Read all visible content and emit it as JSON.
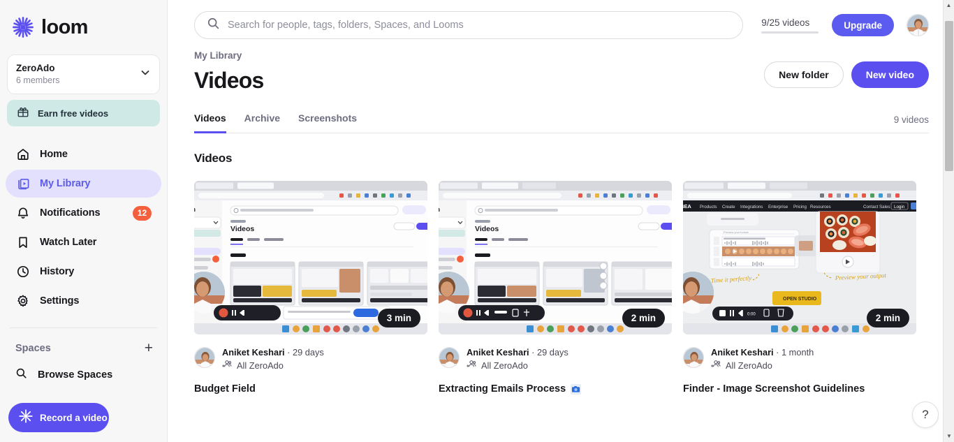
{
  "brand": {
    "name": "loom",
    "logo_icon": "loom-starburst-icon",
    "accent": "#5b4ff0",
    "accent_alt": "#5c5ce8",
    "badge_color": "#f4603e",
    "earn_bg": "#cfe9e6"
  },
  "sidebar": {
    "workspace": {
      "name": "ZeroAdo",
      "members": "6 members",
      "chevron_icon": "chevron-down-icon"
    },
    "earn": {
      "label": "Earn free videos",
      "icon": "gift-icon"
    },
    "items": [
      {
        "label": "Home",
        "icon": "home-icon",
        "active": false
      },
      {
        "label": "My Library",
        "icon": "library-icon",
        "active": true
      },
      {
        "label": "Notifications",
        "icon": "bell-icon",
        "active": false,
        "badge": "12"
      },
      {
        "label": "Watch Later",
        "icon": "bookmark-icon",
        "active": false
      },
      {
        "label": "History",
        "icon": "clock-icon",
        "active": false
      },
      {
        "label": "Settings",
        "icon": "gear-icon",
        "active": false
      }
    ],
    "spaces": {
      "title": "Spaces",
      "add_icon": "plus-icon",
      "browse_label": "Browse Spaces",
      "browse_icon": "search-icon"
    },
    "record": {
      "label": "Record a video",
      "icon": "loom-starburst-icon"
    }
  },
  "topbar": {
    "search": {
      "placeholder": "Search for people, tags, folders, Spaces, and Looms",
      "value": "",
      "icon": "search-icon"
    },
    "quota": {
      "text": "9/25 videos",
      "used": 9,
      "total": 25,
      "percent": 36
    },
    "upgrade_label": "Upgrade",
    "avatar": "user-avatar"
  },
  "page": {
    "breadcrumb": "My Library",
    "title": "Videos",
    "new_folder_label": "New folder",
    "new_video_label": "New video",
    "tabs": [
      {
        "label": "Videos",
        "active": true
      },
      {
        "label": "Archive",
        "active": false
      },
      {
        "label": "Screenshots",
        "active": false
      }
    ],
    "count_text": "9 videos",
    "section_title": "Videos"
  },
  "videos": [
    {
      "title": "Budget Field",
      "title_emoji": "",
      "author": "Aniket Keshari",
      "age": "29 days",
      "space": "All ZeroAdo",
      "space_icon": "people-group-icon",
      "duration": "3 min",
      "thumbnail_kind": "loom-library-recursive"
    },
    {
      "title": "Extracting Emails Process",
      "title_emoji": "📷",
      "author": "Aniket Keshari",
      "age": "29 days",
      "space": "All ZeroAdo",
      "space_icon": "people-group-icon",
      "duration": "2 min",
      "thumbnail_kind": "loom-library-recursive"
    },
    {
      "title": "Finder - Image Screenshot Guidelines",
      "title_emoji": "",
      "author": "Aniket Keshari",
      "age": "1 month",
      "space": "All ZeroAdo",
      "space_icon": "people-group-icon",
      "duration": "2 min",
      "thumbnail_kind": "media-studio-sushi",
      "thumbnail_texts": {
        "cta": "OPEN STUDIO",
        "note_left": "Time it perfectly",
        "note_right": "Preview your output",
        "nav": [
          "Products",
          "Create",
          "Integrations",
          "Enterprise",
          "Pricing",
          "Resources"
        ],
        "nav_right": [
          "Contact Sales",
          "Login"
        ]
      }
    }
  ],
  "help": {
    "label": "?",
    "icon": "question-mark-icon"
  },
  "scrollbar": {
    "up_icon": "caret-up-icon",
    "down_icon": "caret-down-icon"
  }
}
